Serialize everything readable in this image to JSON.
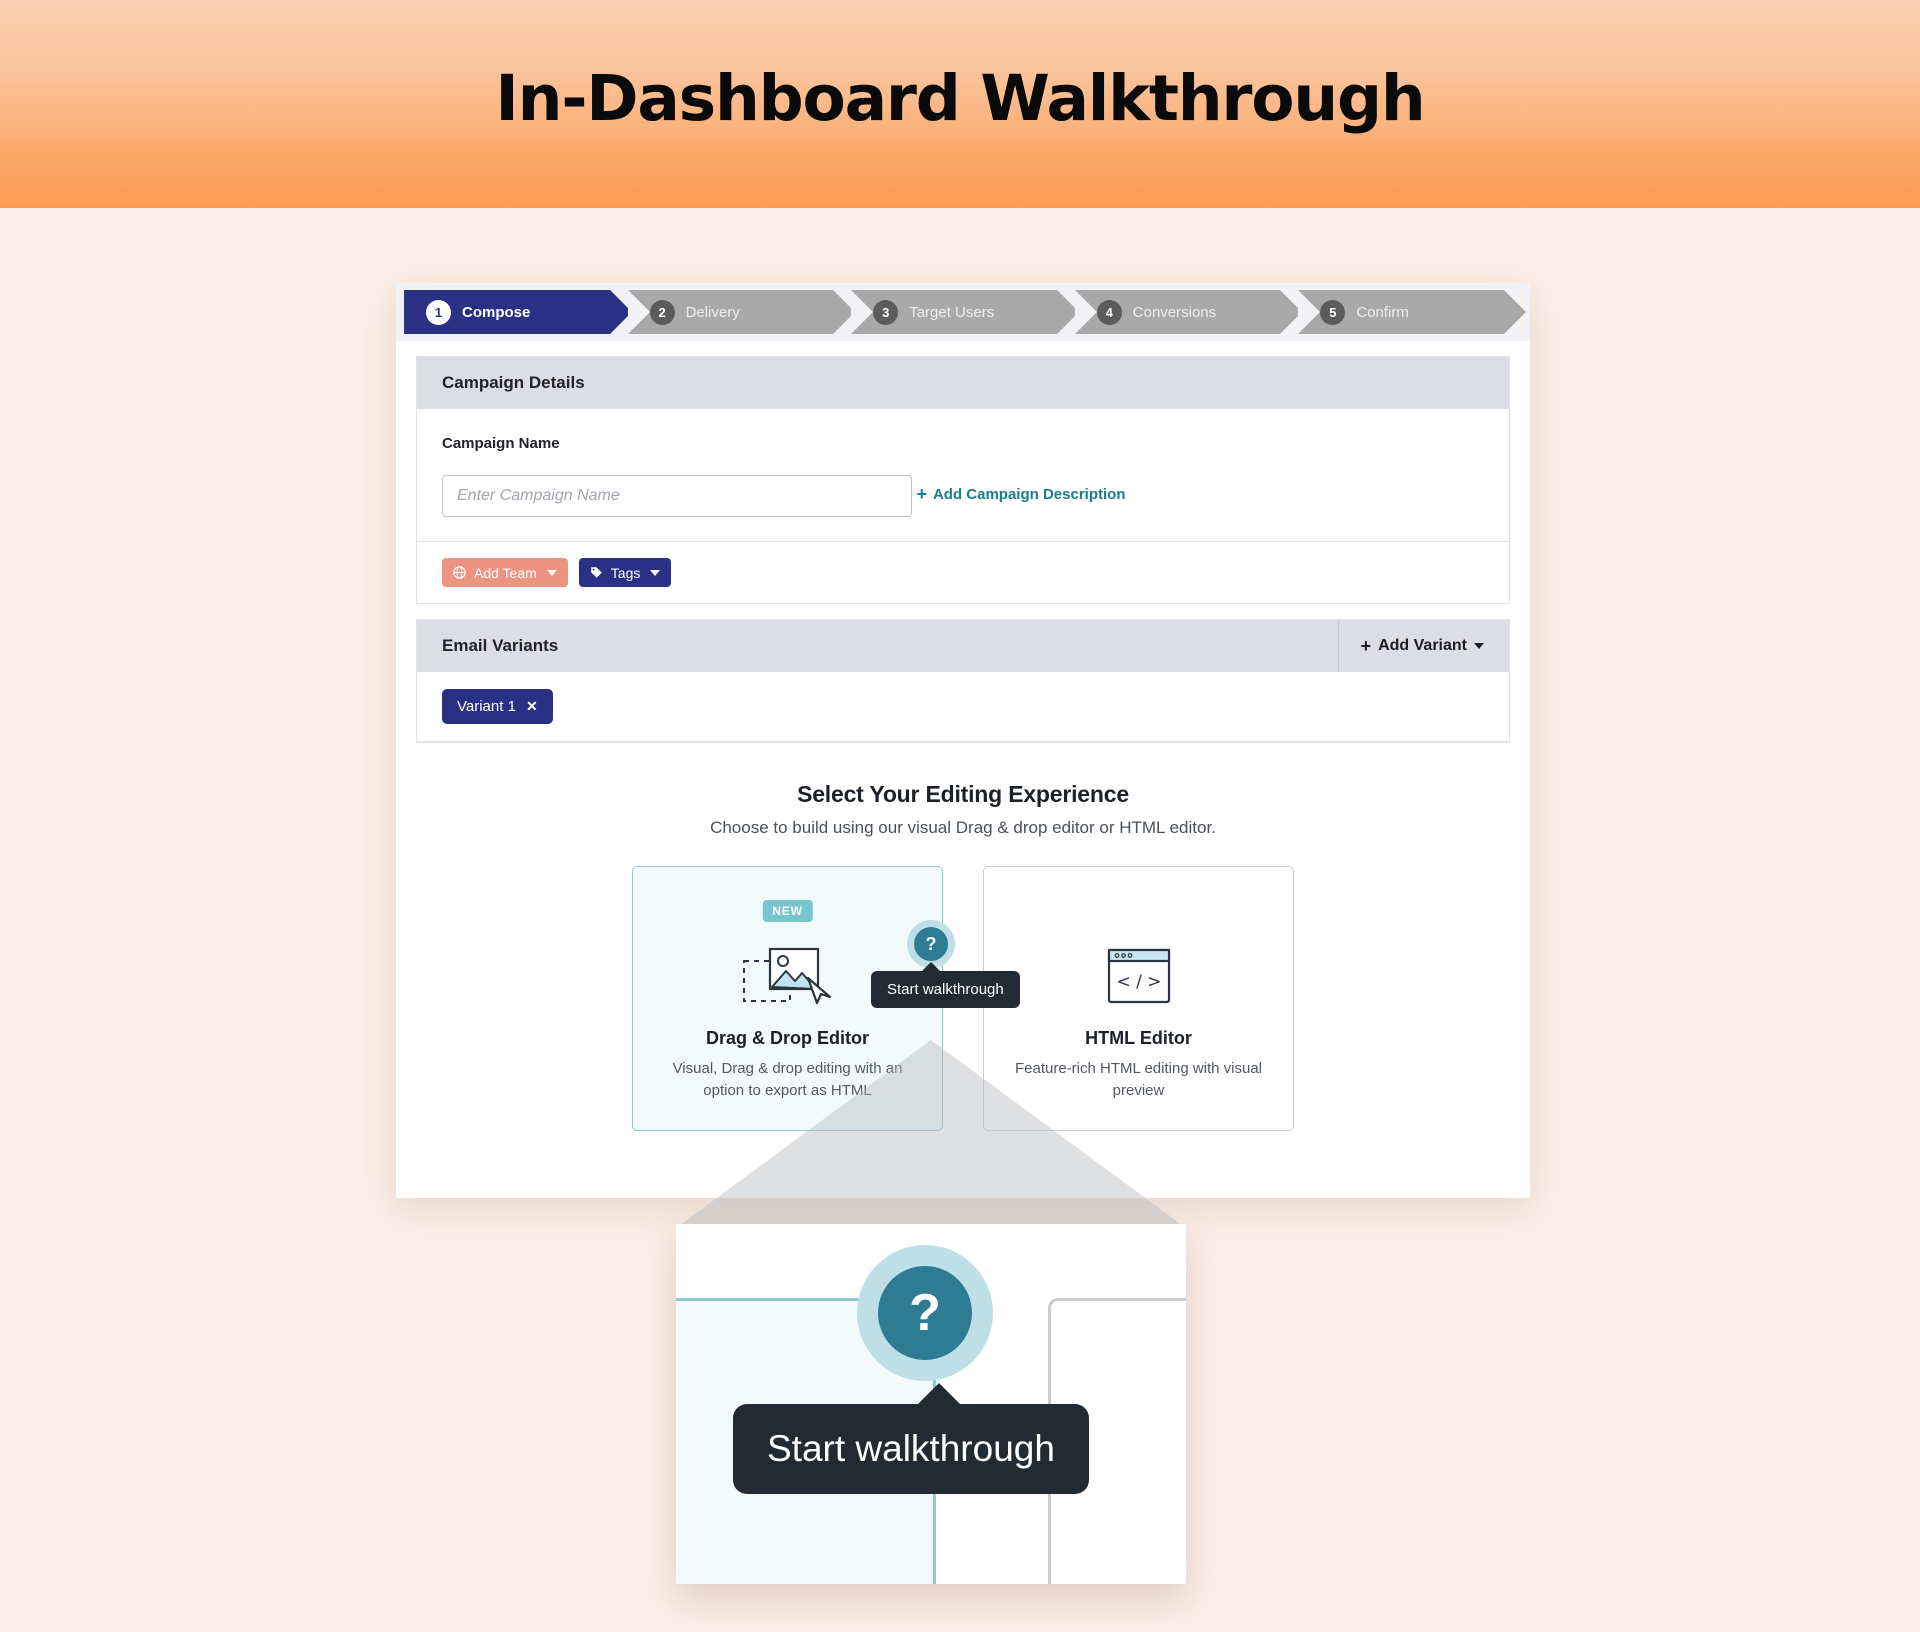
{
  "banner": {
    "title": "In-Dashboard Walkthrough"
  },
  "stepper": {
    "steps": [
      {
        "num": "1",
        "label": "Compose"
      },
      {
        "num": "2",
        "label": "Delivery"
      },
      {
        "num": "3",
        "label": "Target Users"
      },
      {
        "num": "4",
        "label": "Conversions"
      },
      {
        "num": "5",
        "label": "Confirm"
      }
    ]
  },
  "campaign_details": {
    "panel_title": "Campaign Details",
    "name_label": "Campaign Name",
    "name_value": "",
    "name_placeholder": "Enter Campaign Name",
    "add_description_label": "Add Campaign Description",
    "add_description_plus": "+",
    "add_team_label": "Add Team",
    "tags_label": "Tags"
  },
  "email_variants": {
    "panel_title": "Email Variants",
    "add_variant_label": "Add Variant",
    "add_variant_plus": "+",
    "variants": [
      {
        "label": "Variant 1",
        "close": "✕"
      }
    ]
  },
  "editing_experience": {
    "title": "Select Your Editing Experience",
    "subtitle": "Choose to build using our visual Drag & drop editor or HTML editor.",
    "cards": [
      {
        "badge": "NEW",
        "title": "Drag & Drop Editor",
        "description": "Visual, Drag & drop editing with an option to export as HTML",
        "selected": true
      },
      {
        "badge": "",
        "title": "HTML Editor",
        "description": "Feature-rich HTML editing with visual preview",
        "selected": false
      }
    ]
  },
  "help": {
    "glyph": "?",
    "tooltip": "Start walkthrough"
  },
  "zoom_panel": {
    "glyph": "?",
    "tooltip": "Start walkthrough"
  },
  "colors": {
    "accent_orange": "#FD9A52",
    "page_background": "#FCEEE6",
    "brand_navy": "#2A3184",
    "teal": "#2E7C93",
    "teal_light": "#BEDFE6",
    "coral": "#ED9382",
    "tooltip_dark": "#222B33",
    "link_teal": "#1B7C8E"
  }
}
